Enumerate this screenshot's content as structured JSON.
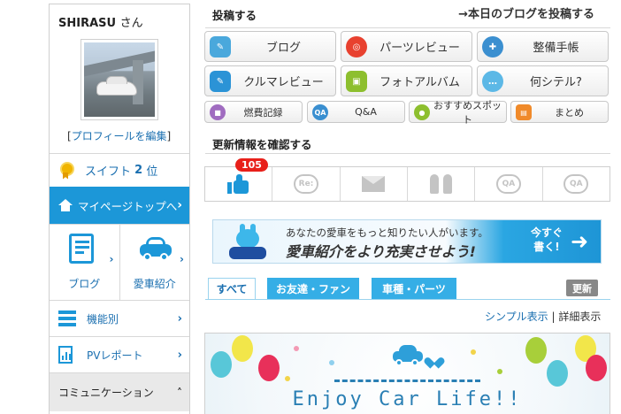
{
  "sidebar": {
    "user_name": "SHIRASU",
    "user_suffix": "さん",
    "profile_edit_open": "[",
    "profile_edit_label": "プロフィールを編集",
    "profile_edit_close": "]",
    "rank_label": "スイフト",
    "rank_value": "2",
    "rank_suffix": "位",
    "mypage_label": "マイページトップへ",
    "tiles": [
      {
        "label": "ブログ",
        "icon": "blog-icon"
      },
      {
        "label": "愛車紹介",
        "icon": "car-icon"
      }
    ],
    "list": [
      {
        "label": "機能別",
        "icon": "list-icon"
      },
      {
        "label": "PVレポート",
        "icon": "report-icon"
      }
    ],
    "community_label": "コミュニケーション"
  },
  "post": {
    "title": "投稿する",
    "today_link": "→本日のブログを投稿する",
    "buttons": [
      {
        "label": "ブログ",
        "icon": "blog-pen-icon",
        "color": "#4aa8dc"
      },
      {
        "label": "パーツレビュー",
        "icon": "steering-wheel-icon",
        "color": "#e8412f"
      },
      {
        "label": "整備手帳",
        "icon": "wrench-icon",
        "color": "#3b8fd0"
      },
      {
        "label": "クルマレビュー",
        "icon": "car-review-icon",
        "color": "#2b93d6"
      },
      {
        "label": "フォトアルバム",
        "icon": "photo-icon",
        "color": "#8dbf2e"
      },
      {
        "label": "何シテル?",
        "icon": "whats-up-icon",
        "color": "#5cb8e6"
      }
    ],
    "small_buttons": [
      {
        "label": "燃費記録",
        "icon": "fuel-icon",
        "color": "#a06cc0"
      },
      {
        "label": "Q&A",
        "icon": "qa-icon",
        "color": "#3a8fd0"
      },
      {
        "label": "おすすめスポット",
        "icon": "spot-icon",
        "color": "#8dbf2e"
      },
      {
        "label": "まとめ",
        "icon": "summary-icon",
        "color": "#f08a2a"
      }
    ]
  },
  "updates": {
    "title": "更新情報を確認する",
    "like_count": "105",
    "icons": [
      "like-icon",
      "reply-icon",
      "mail-icon",
      "friends-icon",
      "qa-gray-icon",
      "qa-answer-icon"
    ]
  },
  "banner": {
    "line1": "あなたの愛車をもっと知りたい人がいます。",
    "line2": "愛車紹介をより充実させよう!",
    "cta_line1": "今すぐ",
    "cta_line2": "書く!"
  },
  "timeline": {
    "tabs": [
      "すべて",
      "お友達・ファン",
      "車種・パーツ"
    ],
    "refresh_label": "更新",
    "view_simple": "シンプル表示",
    "view_separator": "|",
    "view_detail": "詳細表示",
    "card_text": "Enjoy Car Life!!"
  },
  "colors": {
    "accent": "#1c97d8",
    "badge": "#e8201a",
    "tab_active": "#35aee6"
  }
}
